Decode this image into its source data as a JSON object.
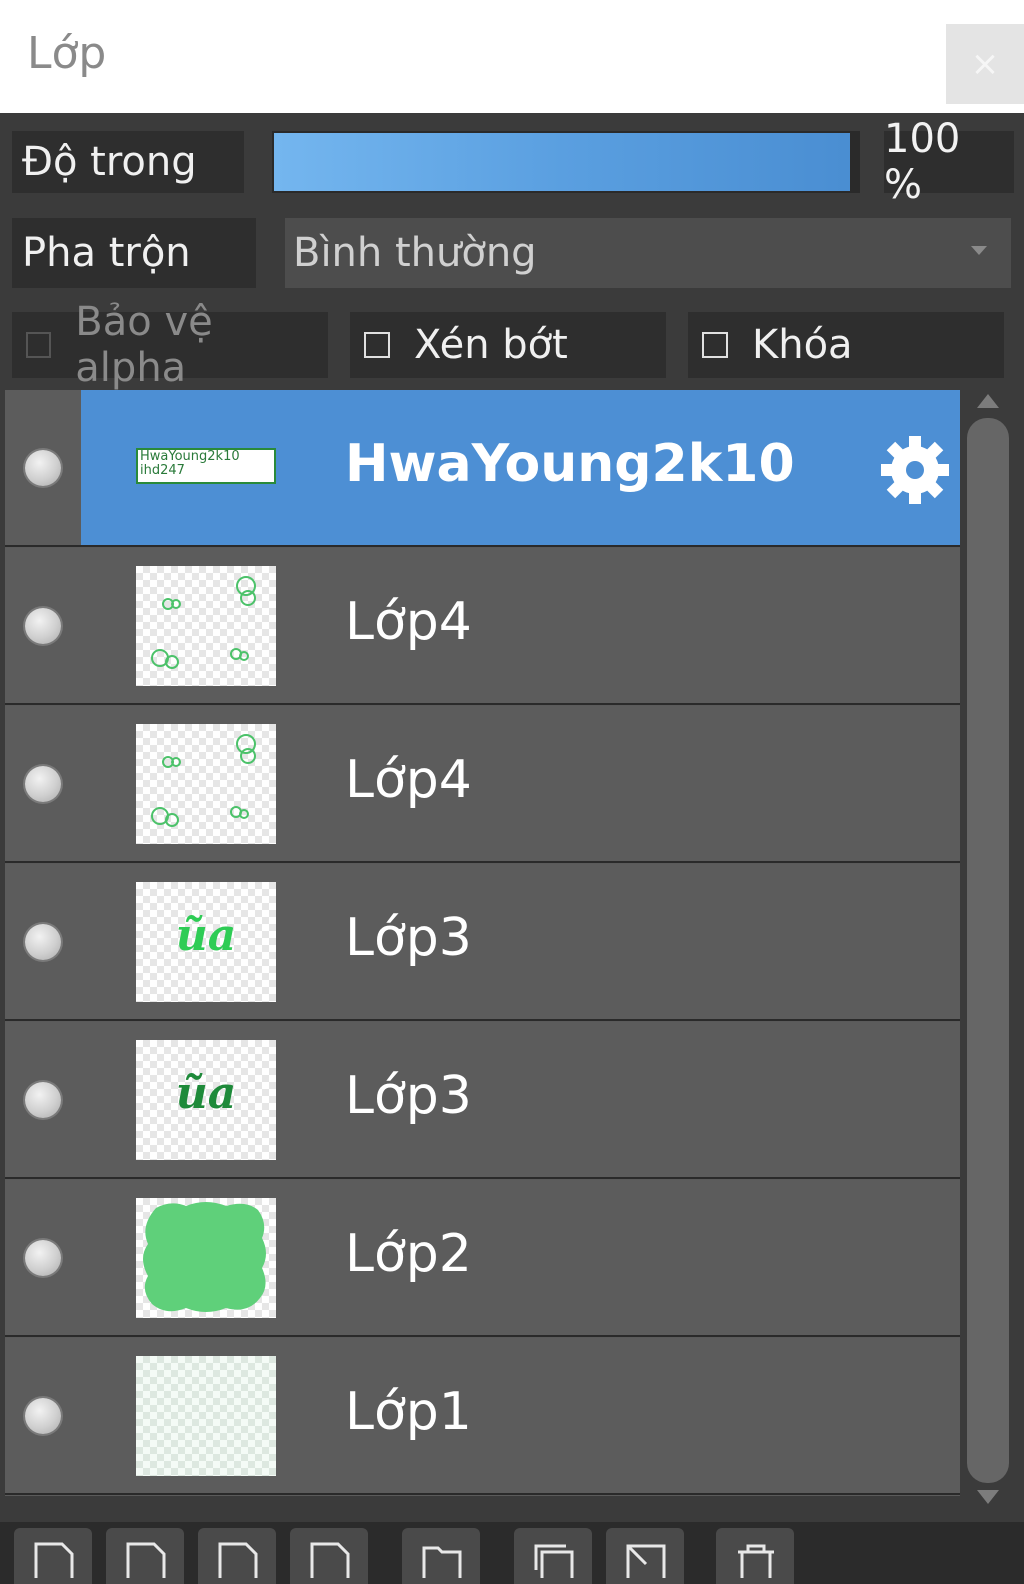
{
  "window": {
    "title": "Lớp",
    "close_label": "×"
  },
  "opacity": {
    "label": "Độ trong",
    "value_text": "100 %",
    "value": 1.0
  },
  "blend": {
    "label": "Pha trộn",
    "selected": "Bình thường"
  },
  "checkboxes": {
    "alpha": {
      "label": "Bảo vệ alpha",
      "checked": false,
      "enabled": false
    },
    "clip": {
      "label": "Xén bớt",
      "checked": false,
      "enabled": true
    },
    "lock": {
      "label": "Khóa",
      "checked": false,
      "enabled": true
    }
  },
  "layers": [
    {
      "name": "HwaYoung2k10",
      "selected": true,
      "thumb": "text",
      "thumb_text": [
        "HwaYoung2k10",
        "ihd247"
      ]
    },
    {
      "name": "Lớp4",
      "selected": false,
      "thumb": "sparse-green"
    },
    {
      "name": "Lớp4",
      "selected": false,
      "thumb": "sparse-green"
    },
    {
      "name": "Lớp3",
      "selected": false,
      "thumb": "word",
      "thumb_text": "ũa",
      "thumb_color": "#2ecc55"
    },
    {
      "name": "Lớp3",
      "selected": false,
      "thumb": "word",
      "thumb_text": "ũa",
      "thumb_color": "#1e8a3a"
    },
    {
      "name": "Lớp2",
      "selected": false,
      "thumb": "blob",
      "thumb_color": "#5fd07a"
    },
    {
      "name": "Lớp1",
      "selected": false,
      "thumb": "faint"
    }
  ],
  "toolbar": {
    "icons": [
      "new-layer-icon",
      "new-layer-alt-icon",
      "add-layer-icon",
      "layer-icon",
      "folder-icon",
      "duplicate-icon",
      "merge-icon",
      "delete-icon"
    ]
  },
  "colors": {
    "accent": "#4d8fd4",
    "panel": "#3b3b3b",
    "row": "#5c5c5c"
  }
}
